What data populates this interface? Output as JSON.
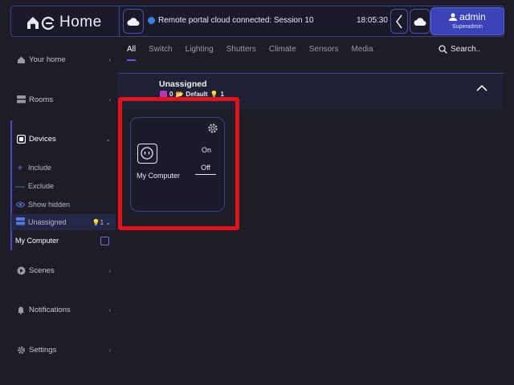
{
  "header": {
    "logo_text": "Home",
    "status_text": "Remote portal cloud connected: Session 10",
    "time": "18:05:30",
    "user": {
      "name": "admin",
      "role": "Superadmin"
    }
  },
  "sidebar": {
    "items": [
      {
        "label": "Your home",
        "icon": "house-icon"
      },
      {
        "label": "Rooms",
        "icon": "rooms-icon"
      },
      {
        "label": "Devices",
        "icon": "device-icon"
      },
      {
        "label": "Scenes",
        "icon": "play-icon"
      },
      {
        "label": "Notifications",
        "icon": "bell-icon"
      },
      {
        "label": "Settings",
        "icon": "gear-icon"
      }
    ],
    "device_actions": [
      {
        "label": "Include",
        "icon": "plus-icon"
      },
      {
        "label": "Exclude",
        "icon": "minus-icon"
      },
      {
        "label": "Show hidden",
        "icon": "eye-icon"
      }
    ],
    "unassigned": {
      "label": "Unassigned",
      "count": "1"
    },
    "current_device": "My Computer"
  },
  "tabs": [
    "All",
    "Switch",
    "Lighting",
    "Shutters",
    "Climate",
    "Sensors",
    "Media"
  ],
  "search": {
    "placeholder": "Search.."
  },
  "group": {
    "title": "Unassigned",
    "devices_count": "0",
    "folder_label": "Default",
    "bulb_count": "1"
  },
  "device_card": {
    "name": "My Computer",
    "on_label": "On",
    "off_label": "Off"
  },
  "colors": {
    "background": "#1e1c26",
    "accent": "#3c42b8",
    "border": "#3b3f8c",
    "highlight": "#e0121b"
  }
}
